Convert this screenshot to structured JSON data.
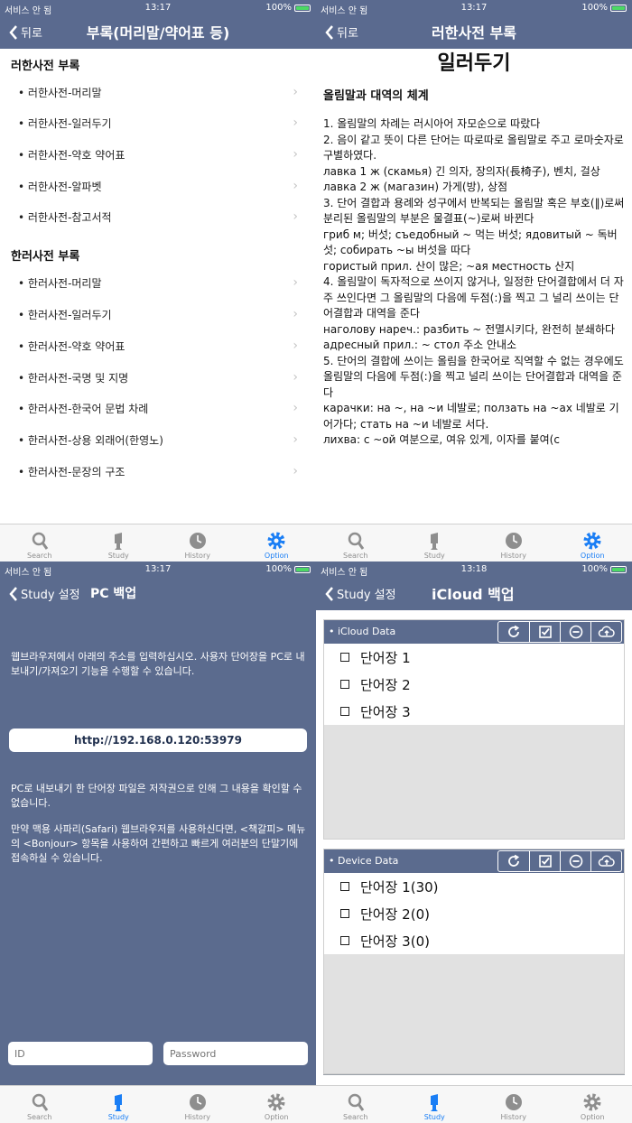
{
  "status": {
    "carrier": "서비스 안 됨",
    "battery": "100%",
    "times": [
      "13:17",
      "13:17",
      "13:17",
      "13:18"
    ]
  },
  "tabs": [
    "Search",
    "Study",
    "History",
    "Option"
  ],
  "screen1": {
    "back": "뒤로",
    "title": "부록(머리말/약어표 등)",
    "sections": [
      {
        "header": "러한사전 부록",
        "items": [
          "러한사전-머리말",
          "러한사전-일러두기",
          "러한사전-약호 약어표",
          "러한사전-알파벳",
          "러한사전-참고서적"
        ]
      },
      {
        "header": "한러사전 부록",
        "items": [
          "한러사전-머리말",
          "한러사전-일러두기",
          "한러사전-약호 약어표",
          "한러사전-국명 및 지명",
          "한러사전-한국어 문법 차례",
          "한러사전-상용 외래어(한영노)",
          "한러사전-문장의 구조"
        ]
      }
    ]
  },
  "screen2": {
    "back": "뒤로",
    "title": "러한사전 부록",
    "doc_title": "일러두기",
    "doc_subtitle": "올림말과 대역의 체계",
    "lines": [
      "1. 올림말의 차례는 러시아어 자모순으로 따랐다",
      "2. 음이 같고 뜻이 다른 단어는 따로따로 올림말로 주고 로마숫자로 구별하였다.",
      "лавка 1 ж (скамья) 긴 의자, 장의자(長椅子), 벤치, 걸상",
      "лавка 2 ж (магазин) 가게(방), 상점",
      "3. 단어 결합과 용례와 성구에서 반복되는 올림말 혹은 부호(‖)로써 분리된 올림말의 부분은 물결표(~)로써 바뀐다",
      "гриб м; 버섯; съедобный ~ 먹는 버섯; ядовитый ~ 독버섯; собирать ~ы 버섯을 따다",
      "гористый прил. 산이 많은; ~ая местность 산지",
      "4. 올림말이 독자적으로 쓰이지 않거나, 일정한 단어결합에서 더 자주 쓰인다면 그 올림말의 다음에 두점(:)을 찍고 그 널리 쓰이는 단어결합과 대역을 준다",
      "наголову нареч.: разбить ~ 전멸시키다, 완전히 분쇄하다",
      "адресный прил.: ~ стол 주소 안내소",
      "5. 단어의 결합에 쓰이는 올림을 한국어로 직역할 수 없는 경우에도 올림말의 다음에 두점(:)을 찍고 널리 쓰이는 단어결합과 대역을 준다",
      "карачки: на ~, на ~и 네발로; ползать на ~ах 네발로 기어가다; стать на ~и 네발로 서다.",
      "лихва: с ~ой 여분으로, 여유 있게, 이자를 붙여(с"
    ]
  },
  "screen3": {
    "back": "Study 설정",
    "title": "PC 백업",
    "intro": "웹브라우저에서 아래의 주소를 입력하십시오. 사용자 단어장을 PC로 내보내기/가져오기 기능을 수행할 수 있습니다.",
    "url": "http://192.168.0.120:53979",
    "note1": "PC로 내보내기 한 단어장 파일은 저작권으로 인해 그 내용을 확인할 수 없습니다.",
    "note2": "만약 맥용 사파리(Safari) 웹브라우저를 사용하신다면, <책갈피> 메뉴의 <Bonjour> 항목을 사용하여 간편하고 빠르게 여러분의 단말기에 접속하실 수 있습니다.",
    "id_placeholder": "ID",
    "password_placeholder": "Password"
  },
  "screen4": {
    "back": "Study 설정",
    "title": "iCloud 백업",
    "icloud_header": "iCloud Data",
    "icloud_items": [
      "단어장 1",
      "단어장 2",
      "단어장 3"
    ],
    "device_header": "Device Data",
    "device_items": [
      "단어장 1(30)",
      "단어장 2(0)",
      "단어장 3(0)"
    ]
  }
}
